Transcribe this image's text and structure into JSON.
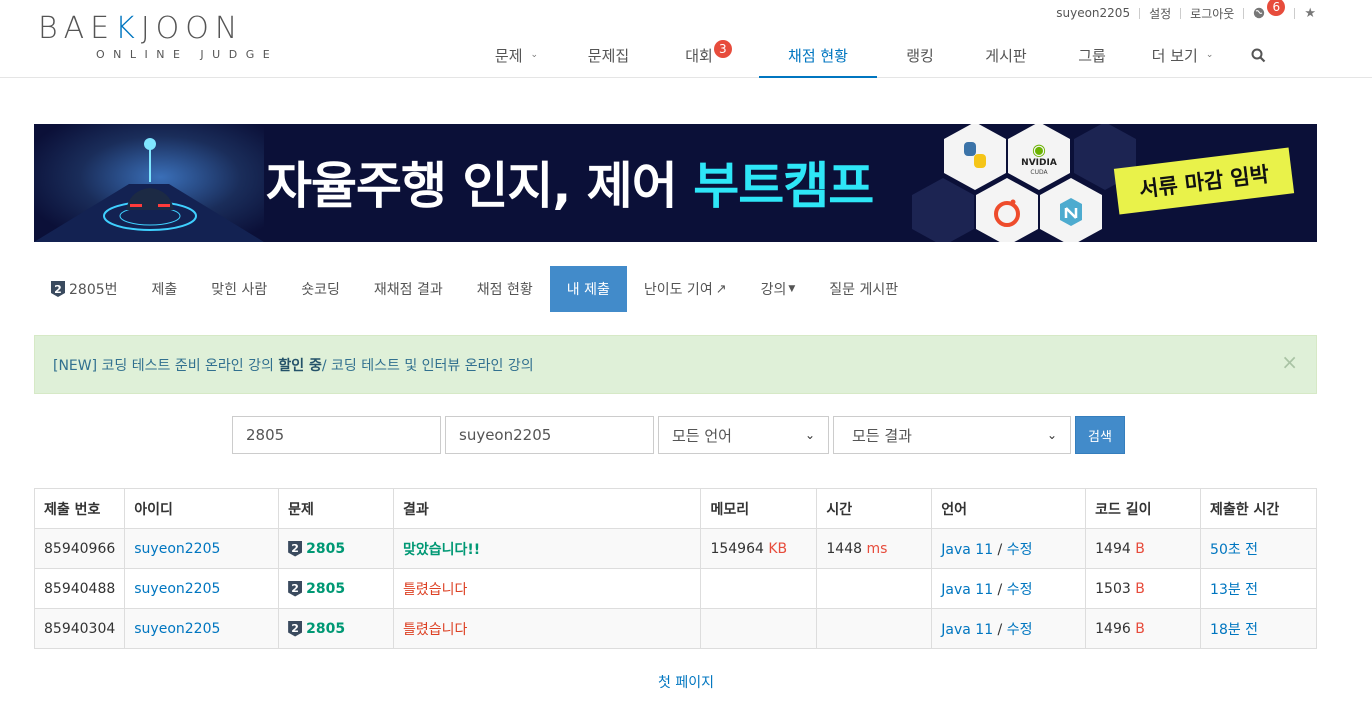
{
  "logo": {
    "main_left": "BAE",
    "main_k": "K",
    "main_right": "JOON",
    "sub": "ONLINE JUDGE"
  },
  "topbar": {
    "username": "suyeon2205",
    "settings": "설정",
    "logout": "로그아웃",
    "notifications": "6"
  },
  "nav": {
    "items": [
      {
        "label": "문제",
        "caret": true,
        "badge": ""
      },
      {
        "label": "문제집",
        "caret": false,
        "badge": ""
      },
      {
        "label": "대회",
        "caret": false,
        "badge": "3"
      },
      {
        "label": "채점 현황",
        "caret": false,
        "badge": "",
        "active": true
      },
      {
        "label": "랭킹",
        "caret": false,
        "badge": ""
      },
      {
        "label": "게시판",
        "caret": false,
        "badge": ""
      },
      {
        "label": "그룹",
        "caret": false,
        "badge": ""
      },
      {
        "label": "더 보기",
        "caret": true,
        "badge": ""
      }
    ]
  },
  "banner": {
    "title_white": "자율주행 인지, 제어 ",
    "title_cyan": "부트캠프",
    "tag": "서류 마감 임박",
    "nvidia": "NVIDIA",
    "cuda": "CUDA"
  },
  "problem_menu": {
    "tier": "2",
    "problem": "2805번",
    "submit": "제출",
    "solved": "맞힌 사람",
    "short": "숏코딩",
    "rejudge": "재채점 결과",
    "status": "채점 현황",
    "my": "내 제출",
    "difficulty": "난이도 기여",
    "lecture": "강의",
    "qna": "질문 게시판"
  },
  "alert": {
    "part1": "[NEW] 코딩 테스트 준비 온라인 강의 ",
    "part2": "할인 중",
    "part3": " / 코딩 테스트 및 인터뷰 온라인 강의",
    "close": "×"
  },
  "form": {
    "problem": "2805",
    "user": "suyeon2205",
    "language": "모든 언어",
    "result": "모든 결과",
    "search": "검색"
  },
  "table": {
    "headers": [
      "제출 번호",
      "아이디",
      "문제",
      "결과",
      "메모리",
      "시간",
      "언어",
      "코드 길이",
      "제출한 시간"
    ],
    "rows": [
      {
        "id": "85940966",
        "user": "suyeon2205",
        "tier": "2",
        "problem": "2805",
        "result": "맞았습니다!!",
        "ok": true,
        "memory": "154964",
        "memory_unit": "KB",
        "time": "1448",
        "time_unit": "ms",
        "lang": "Java 11",
        "edit": "수정",
        "length": "1494",
        "length_unit": "B",
        "submitted": "50초 전"
      },
      {
        "id": "85940488",
        "user": "suyeon2205",
        "tier": "2",
        "problem": "2805",
        "result": "틀렸습니다",
        "ok": false,
        "memory": "",
        "memory_unit": "",
        "time": "",
        "time_unit": "",
        "lang": "Java 11",
        "edit": "수정",
        "length": "1503",
        "length_unit": "B",
        "submitted": "13분 전"
      },
      {
        "id": "85940304",
        "user": "suyeon2205",
        "tier": "2",
        "problem": "2805",
        "result": "틀렸습니다",
        "ok": false,
        "memory": "",
        "memory_unit": "",
        "time": "",
        "time_unit": "",
        "lang": "Java 11",
        "edit": "수정",
        "length": "1496",
        "length_unit": "B",
        "submitted": "18분 전"
      }
    ]
  },
  "pager": {
    "first": "첫 페이지"
  },
  "colors": {
    "accent": "#0076c0",
    "active_tab": "#428bca",
    "success": "#009874",
    "error": "#dd4124",
    "badge": "#e74c3c"
  }
}
